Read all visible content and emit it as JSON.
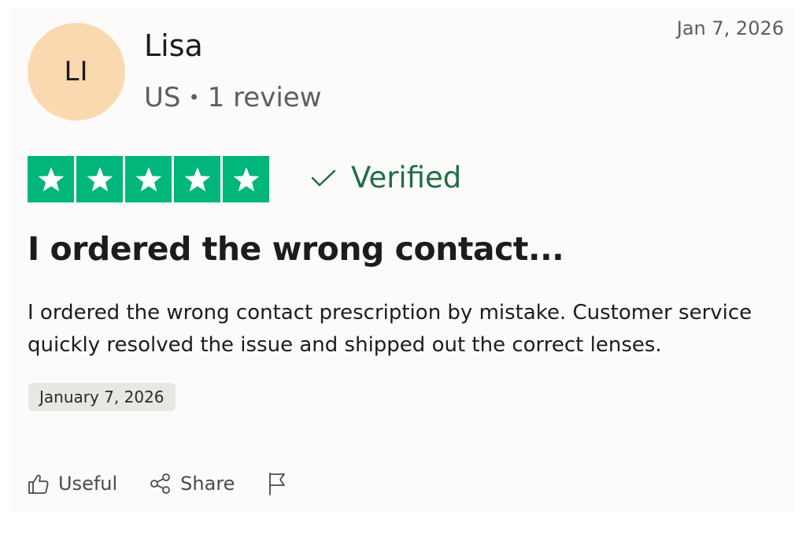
{
  "reviewer": {
    "initials": "LI",
    "name": "Lisa",
    "country": "US",
    "separator": "•",
    "review_count": "1 review"
  },
  "review": {
    "date_posted": "Jan 7, 2026",
    "rating": 5,
    "rating_max": 5,
    "star_color": "#00b67a",
    "verified_label": "Verified",
    "title": "I ordered the wrong contact...",
    "body": "I ordered the wrong contact prescription by mistake. Customer service quickly resolved the issue and shipped out the correct lenses.",
    "experience_date": "January 7, 2026"
  },
  "actions": {
    "useful_label": "Useful",
    "useful_icon": "thumbs-up-icon",
    "share_label": "Share",
    "share_icon": "share-icon",
    "report_icon": "flag-icon"
  },
  "colors": {
    "avatar_bg": "#fbd9b0",
    "verified": "#1f6f43"
  }
}
